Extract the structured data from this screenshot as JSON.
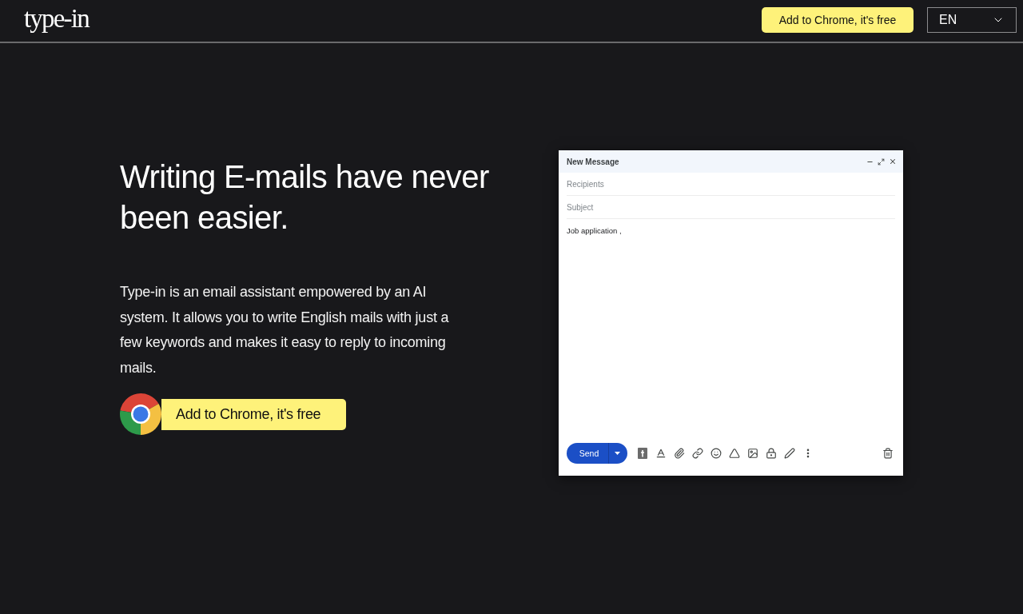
{
  "header": {
    "logo": "type-in",
    "cta_button": "Add to Chrome, it's free",
    "language_select": {
      "value": "EN"
    }
  },
  "hero": {
    "heading": "Writing E-mails have never been easier.",
    "description": "Type-in is an email assistant empowered by an AI system. It allows you to write English mails with just a few keywords and makes it easy to reply to incoming mails.",
    "cta_button": "Add to Chrome, it's free"
  },
  "compose_window": {
    "title": "New Message",
    "recipients": {
      "placeholder": "Recipients"
    },
    "subject": {
      "placeholder": "Subject"
    },
    "body": {
      "value": "Job application ,"
    },
    "send_button": "Send"
  }
}
